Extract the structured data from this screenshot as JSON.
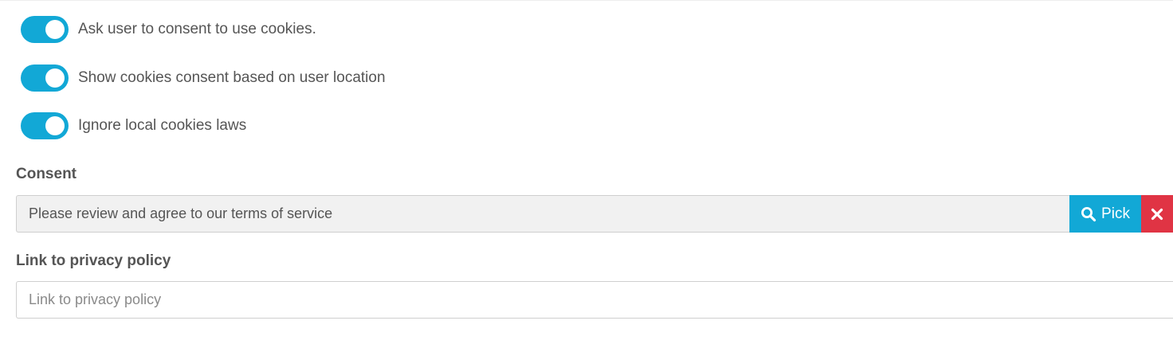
{
  "toggles": [
    {
      "label": "Ask user to consent to use cookies.",
      "checked": true
    },
    {
      "label": "Show cookies consent based on user location",
      "checked": true
    },
    {
      "label": "Ignore local cookies laws",
      "checked": true
    }
  ],
  "consent": {
    "label": "Consent",
    "value": "Please review and agree to our terms of service",
    "pick_label": "Pick",
    "pick_icon": "search-icon",
    "clear_icon": "close-icon"
  },
  "privacy": {
    "label": "Link to privacy policy",
    "value": "",
    "placeholder": "Link to privacy policy"
  },
  "colors": {
    "accent": "#12a8d6",
    "danger": "#e03444",
    "text": "#555555",
    "readonly_bg": "#f1f1f1"
  }
}
